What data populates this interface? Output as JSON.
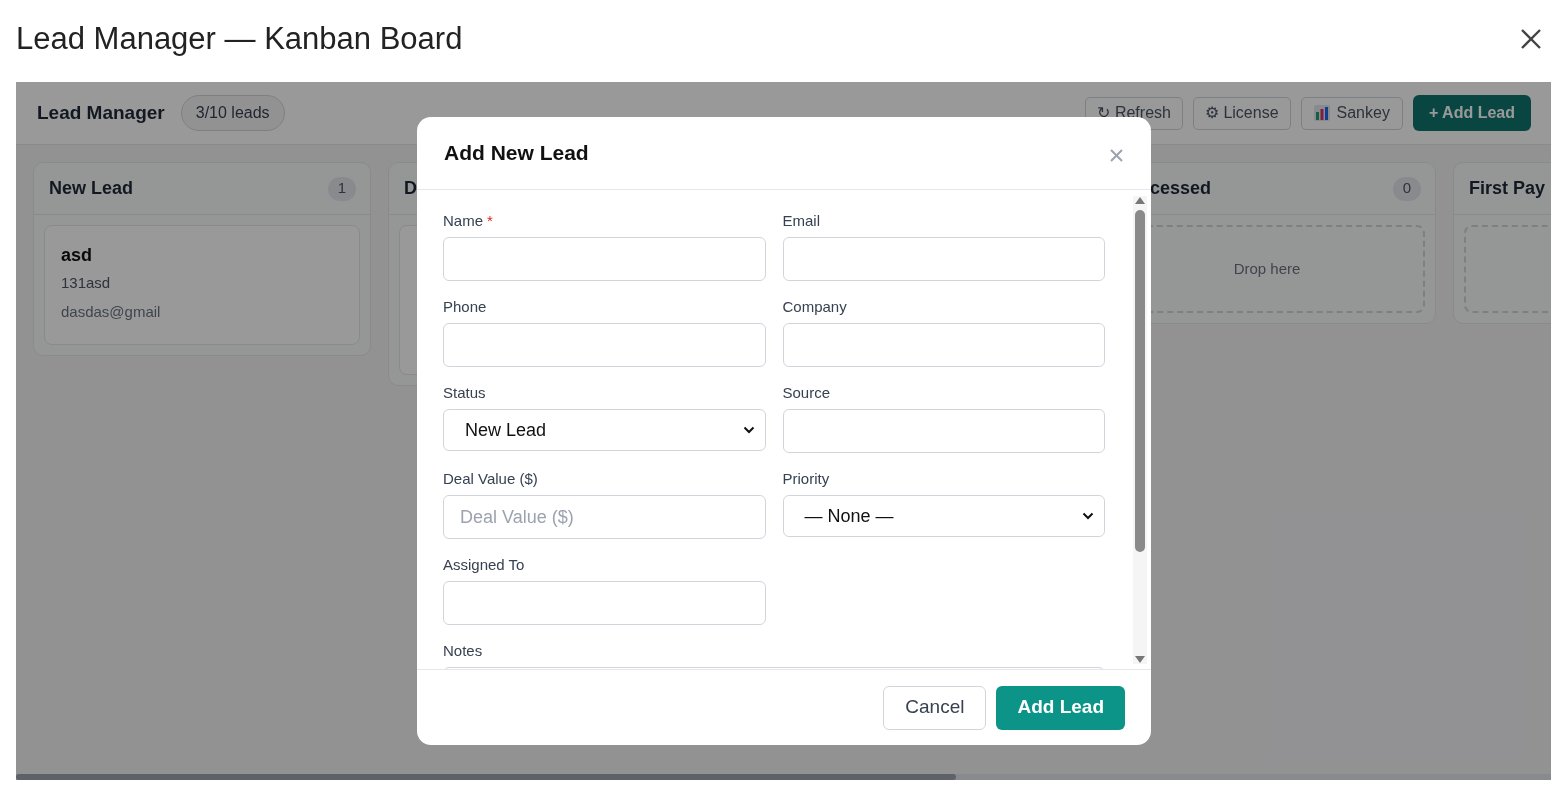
{
  "window": {
    "title": "Lead Manager — Kanban Board"
  },
  "board": {
    "title": "Lead Manager",
    "count_badge": "3/10 leads",
    "toolbar": [
      {
        "kind": "refresh",
        "label": "↻ Refresh"
      },
      {
        "kind": "license",
        "label": "⚙ License"
      },
      {
        "kind": "sankey",
        "label": "Sankey"
      },
      {
        "kind": "primary",
        "label": "+ Add Lead"
      }
    ],
    "columns": [
      {
        "title": "New Lead",
        "count": "1",
        "kind": "cards",
        "cards": [
          {
            "name": "asd",
            "phone": "131asd",
            "email": "dasdas@gmail"
          }
        ]
      },
      {
        "title": "D",
        "kind": "covered"
      },
      {
        "title": "cessed",
        "count": "0",
        "kind": "drop",
        "drop_text": "Drop here"
      },
      {
        "title": "First Pay",
        "kind": "drop"
      }
    ]
  },
  "dialog": {
    "title": "Add New Lead",
    "fields": [
      {
        "kind": "text",
        "label": "Name",
        "required_mark": "*"
      },
      {
        "kind": "text",
        "label": "Email"
      },
      {
        "kind": "text",
        "label": "Phone"
      },
      {
        "kind": "text",
        "label": "Company"
      },
      {
        "kind": "select",
        "label": "Status",
        "value": "New Lead"
      },
      {
        "kind": "text",
        "label": "Source"
      },
      {
        "kind": "text",
        "label": "Deal Value ($)",
        "placeholder": "Deal Value ($)"
      },
      {
        "kind": "select",
        "label": "Priority",
        "value": "— None —"
      },
      {
        "kind": "text",
        "label": "Assigned To"
      },
      {
        "kind": "textarea",
        "label": "Notes"
      }
    ],
    "buttons": [
      {
        "kind": "secondary",
        "label": "Cancel"
      },
      {
        "kind": "primary",
        "label": "Add Lead"
      }
    ]
  }
}
